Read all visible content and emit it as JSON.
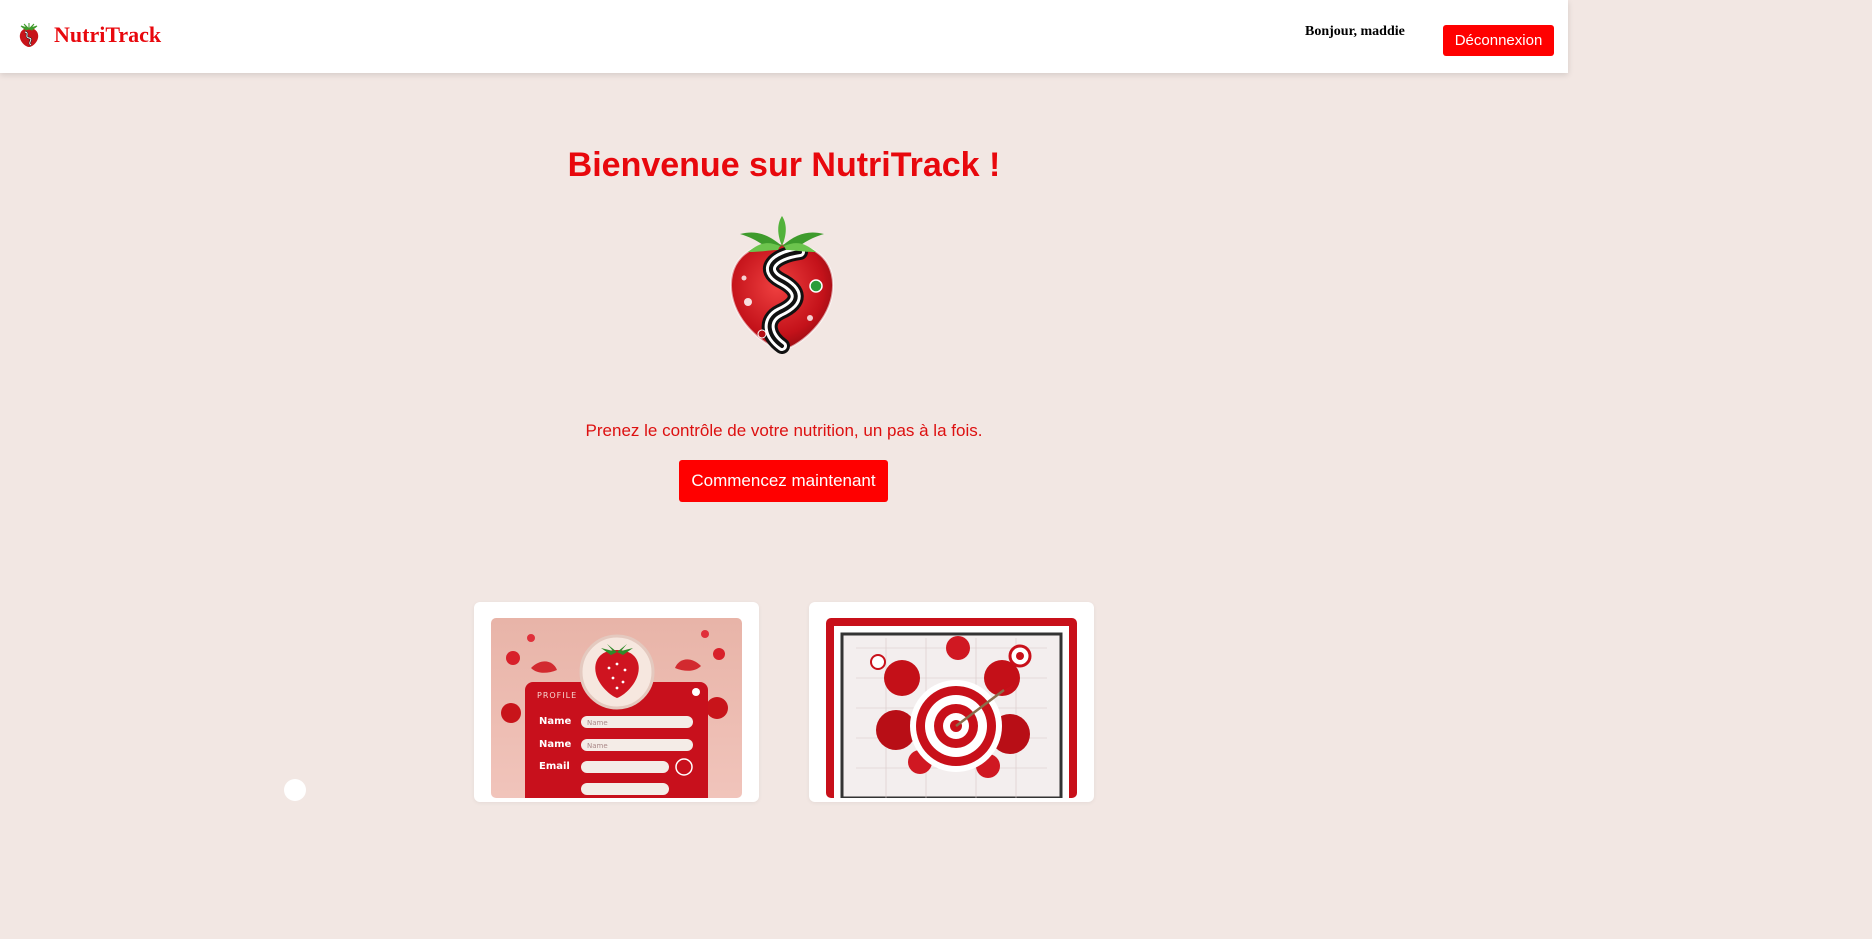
{
  "header": {
    "brand_name": "NutriTrack",
    "logo_icon": "strawberry-logo-icon",
    "greeting": "Bonjour, maddie",
    "logout_label": "Déconnexion"
  },
  "hero": {
    "title": "Bienvenue sur NutriTrack !",
    "logo_icon": "strawberry-logo-icon",
    "tagline": "Prenez le contrôle de votre nutrition, un pas à la fois.",
    "cta_label": "Commencez maintenant"
  },
  "cards": [
    {
      "image": "profile-form-illustration",
      "image_text": {
        "heading": "PROFILE",
        "label_1": "Name",
        "label_2": "Name",
        "label_3": "Email",
        "field_placeholder_1": "Name",
        "field_placeholder_2": "Name"
      }
    },
    {
      "image": "target-goal-illustration"
    }
  ],
  "colors": {
    "accent": "#ff0000",
    "title_red": "#e8080d",
    "background": "#f2e7e3",
    "header_bg": "#ffffff"
  }
}
